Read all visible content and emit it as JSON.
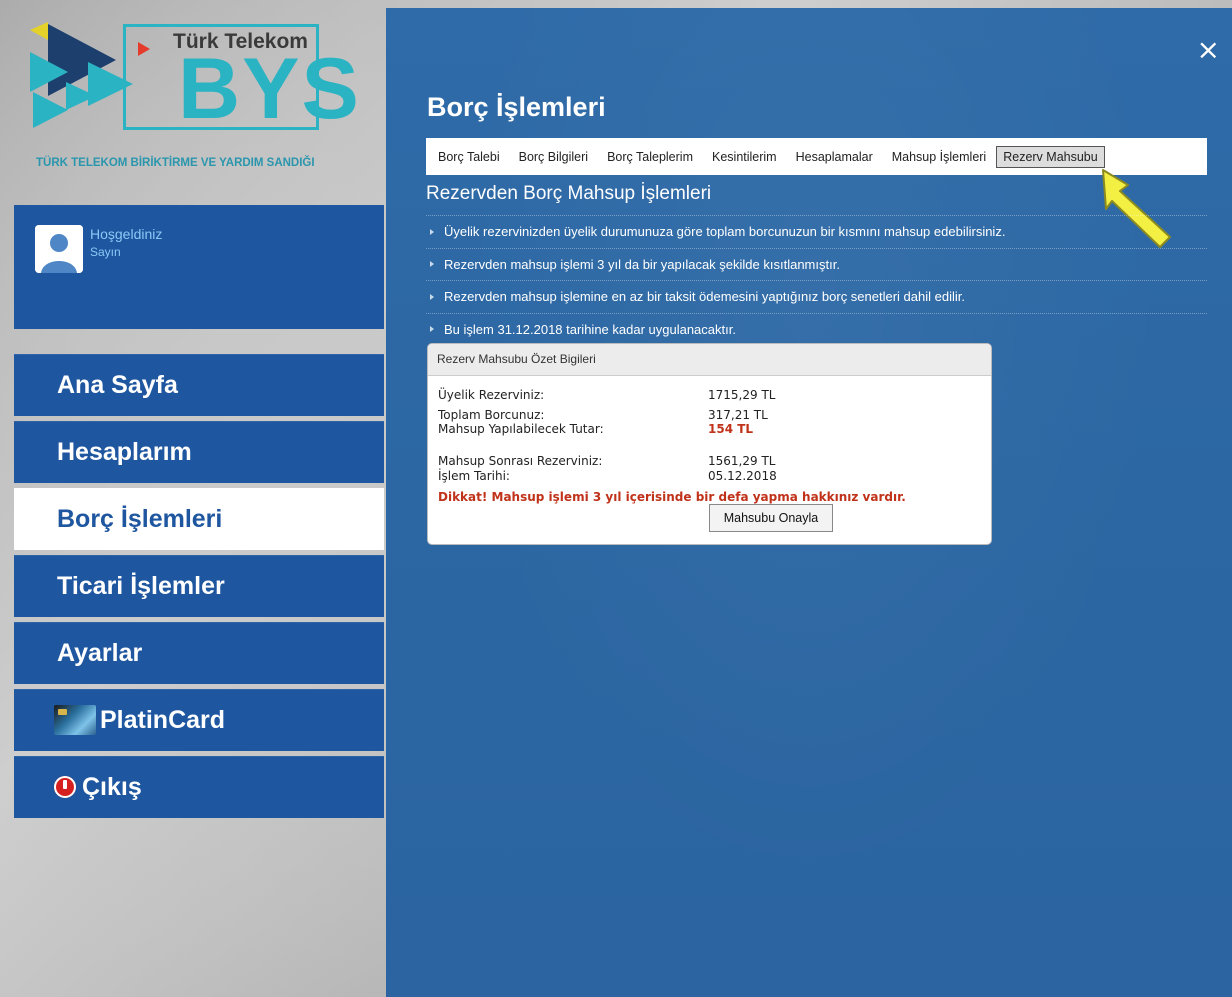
{
  "logo": {
    "brand": "Türk Telekom",
    "mark": "BYS",
    "tagline": "TÜRK TELEKOM BİRİKTİRME VE YARDIM SANDIĞI"
  },
  "welcome": {
    "title": "Hoşgeldiniz",
    "subtitle": "Sayın"
  },
  "nav": {
    "items": [
      {
        "label": "Ana Sayfa"
      },
      {
        "label": "Hesaplarım"
      },
      {
        "label": "Borç İşlemleri",
        "active": true
      },
      {
        "label": "Ticari İşlemler"
      },
      {
        "label": "Ayarlar"
      },
      {
        "label": "PlatinCard",
        "icon": "credit-card-icon"
      },
      {
        "label": "Çıkış",
        "icon": "power-icon"
      }
    ]
  },
  "main": {
    "close": "×",
    "title": "Borç İşlemleri",
    "tabs": [
      {
        "label": "Borç Talebi"
      },
      {
        "label": "Borç Bilgileri"
      },
      {
        "label": "Borç Taleplerim"
      },
      {
        "label": "Kesintilerim"
      },
      {
        "label": "Hesaplamalar"
      },
      {
        "label": "Mahsup İşlemleri"
      },
      {
        "label": "Rezerv Mahsubu",
        "active": true
      }
    ],
    "section_title": "Rezervden Borç Mahsup İşlemleri",
    "info": [
      "Üyelik rezervinizden üyelik durumunuza göre toplam borcunuzun bir kısmını mahsup edebilirsiniz.",
      "Rezervden mahsup işlemi 3 yıl da bir yapılacak şekilde kısıtlanmıştır.",
      "Rezervden mahsup işlemine en az bir taksit ödemesini yaptığınız borç senetleri dahil edilir.",
      "Bu işlem 31.12.2018 tarihine kadar uygulanacaktır."
    ],
    "summary": {
      "header": "Rezerv Mahsubu Özet Bigileri",
      "rows": [
        {
          "label": "Üyelik Rezerviniz:",
          "value": "1715,29 TL"
        },
        {
          "label": "Toplam Borcunuz:",
          "value": "317,21 TL"
        },
        {
          "label": "Mahsup Yapılabilecek Tutar:",
          "value": "154 TL"
        },
        {
          "label": "Mahsup Sonrası Rezerviniz:",
          "value": "1561,29 TL"
        },
        {
          "label": "İşlem Tarihi:",
          "value": "05.12.2018"
        }
      ],
      "warning": "Dikkat! Mahsup işlemi 3 yıl içerisinde bir defa yapma hakkınız vardır.",
      "confirm_button": "Mahsubu Onayla"
    }
  },
  "colors": {
    "nav_blue": "#1e56a0",
    "panel_blue": "#2c67a3",
    "logo_teal": "#2ab3c3",
    "warning_red": "#c0321a"
  }
}
